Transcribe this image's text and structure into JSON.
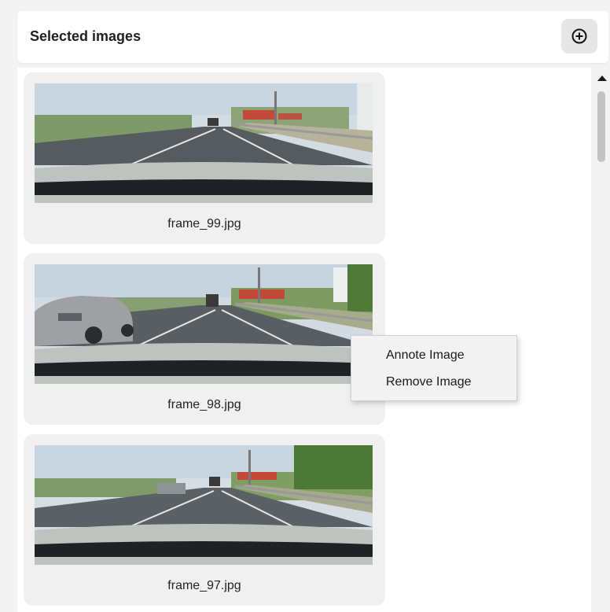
{
  "header": {
    "title": "Selected images"
  },
  "add_button": {
    "icon": "plus-circle-icon"
  },
  "images": [
    {
      "caption": "frame_99.jpg"
    },
    {
      "caption": "frame_98.jpg"
    },
    {
      "caption": "frame_97.jpg"
    }
  ],
  "context_menu": {
    "items": [
      {
        "label": "Annote Image"
      },
      {
        "label": "Remove Image"
      }
    ]
  },
  "colors": {
    "panel_bg": "#f3f3f3",
    "card_bg": "#f0f0f0",
    "menu_bg": "#f2f2f2",
    "scroll_thumb": "#c2c2c2"
  }
}
